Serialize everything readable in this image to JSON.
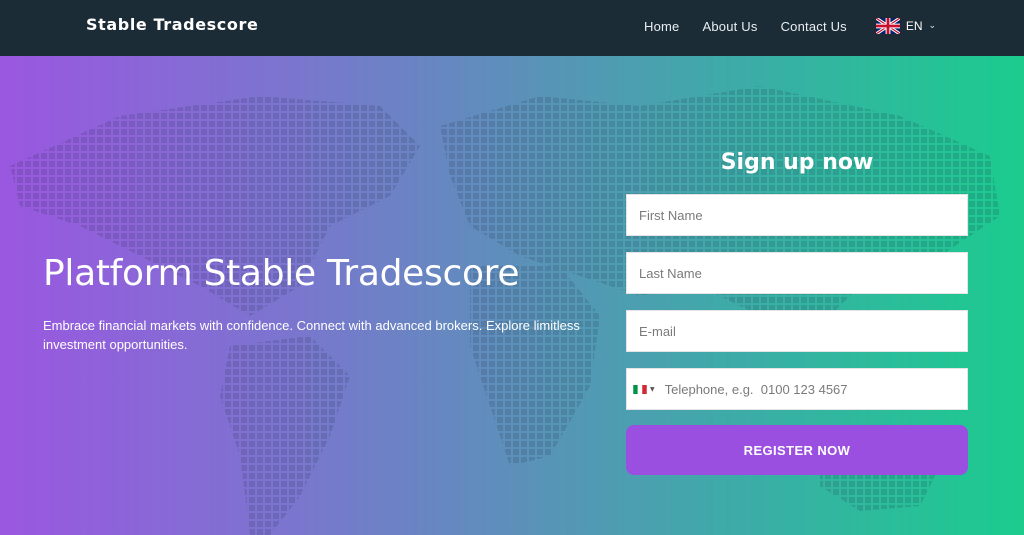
{
  "header": {
    "brand": "Stable Tradescore",
    "nav": [
      {
        "label": "Home"
      },
      {
        "label": "About Us"
      },
      {
        "label": "Contact Us"
      }
    ],
    "language": {
      "code": "EN",
      "flag_icon": "uk-flag-icon"
    }
  },
  "hero": {
    "headline": "Platform Stable Tradescore",
    "subtext": "Embrace financial markets with confidence. Connect with advanced brokers. Explore limitless investment opportunities."
  },
  "signup": {
    "title": "Sign up now",
    "first_name_placeholder": "First Name",
    "last_name_placeholder": "Last Name",
    "email_placeholder": "E-mail",
    "phone_placeholder": "Telephone, e.g.  0100 123 4567",
    "phone_country_icon": "italy-flag-icon",
    "submit_label": "REGISTER NOW"
  },
  "colors": {
    "topbar": "#1c2c36",
    "gradient_start": "#9a57e0",
    "gradient_end": "#1bcc8e",
    "button": "#9a4fe0"
  }
}
